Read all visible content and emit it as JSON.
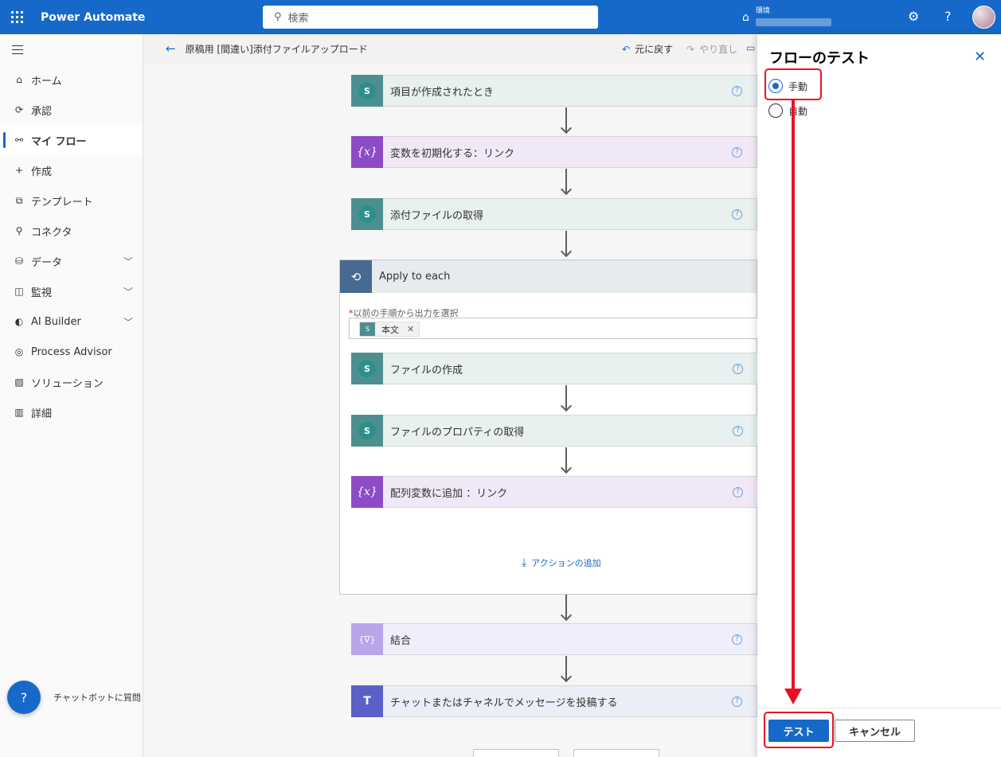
{
  "app": {
    "title": "Power Automate",
    "search_placeholder": "検索",
    "environment_label": "環境",
    "help_icon": "?"
  },
  "nav": {
    "items": [
      {
        "label": "ホーム",
        "icon": "home-icon",
        "glyph": "⌂"
      },
      {
        "label": "承認",
        "icon": "approvals-icon",
        "glyph": "⟳"
      },
      {
        "label": "マイ フロー",
        "icon": "my-flows-icon",
        "glyph": "⚯",
        "active": true
      },
      {
        "label": "作成",
        "icon": "plus-icon",
        "glyph": "+"
      },
      {
        "label": "テンプレート",
        "icon": "templates-icon",
        "glyph": "⧉"
      },
      {
        "label": "コネクタ",
        "icon": "connectors-icon",
        "glyph": "⚲"
      },
      {
        "label": "データ",
        "icon": "data-icon",
        "glyph": "⛁",
        "expand": true
      },
      {
        "label": "監視",
        "icon": "monitor-icon",
        "glyph": "◫",
        "expand": true
      },
      {
        "label": "AI Builder",
        "icon": "ai-builder-icon",
        "glyph": "◐",
        "expand": true
      },
      {
        "label": "Process Advisor",
        "icon": "process-advisor-icon",
        "glyph": "◎"
      },
      {
        "label": "ソリューション",
        "icon": "solutions-icon",
        "glyph": "▧"
      },
      {
        "label": "詳細",
        "icon": "learn-icon",
        "glyph": "▥"
      }
    ],
    "chatbot_label": "チャットボットに質問"
  },
  "command_bar": {
    "flow_name": "原稿用 [間違い]添付ファイルアップロード",
    "undo": "元に戻す",
    "redo": "やり直し"
  },
  "flow": {
    "steps": [
      {
        "label": "項目が作成されたとき",
        "type": "sharepoint",
        "icon": "sharepoint-icon"
      },
      {
        "label": "変数を初期化する：リンク",
        "type": "variable",
        "icon": "variable-icon"
      },
      {
        "label": "添付ファイルの取得",
        "type": "sharepoint",
        "icon": "sharepoint-icon"
      }
    ],
    "apply_to_each": {
      "title": "Apply to each",
      "field_label": "以前の手順から出力を選択",
      "required_mark": "*",
      "token": "本文",
      "inner_steps": [
        {
          "label": "ファイルの作成",
          "type": "sharepoint"
        },
        {
          "label": "ファイルのプロパティの取得",
          "type": "sharepoint"
        },
        {
          "label": "配列変数に追加 ：リンク",
          "type": "variable"
        }
      ],
      "add_action": "アクションの追加"
    },
    "after_steps": [
      {
        "label": "結合",
        "type": "join",
        "icon": "join-icon"
      },
      {
        "label": "チャットまたはチャネルでメッセージを投稿する",
        "type": "teams",
        "icon": "teams-icon"
      }
    ]
  },
  "test_panel": {
    "title": "フローのテスト",
    "options": [
      {
        "label": "手動",
        "checked": true
      },
      {
        "label": "自動",
        "checked": false
      }
    ],
    "test_button": "テスト",
    "cancel_button": "キャンセル"
  },
  "colors": {
    "brand": "#1669c8",
    "sharepoint": "#4d8f8f",
    "variable": "#8d4bc7",
    "teams": "#5b5fc7",
    "annotation": "#e81123"
  }
}
